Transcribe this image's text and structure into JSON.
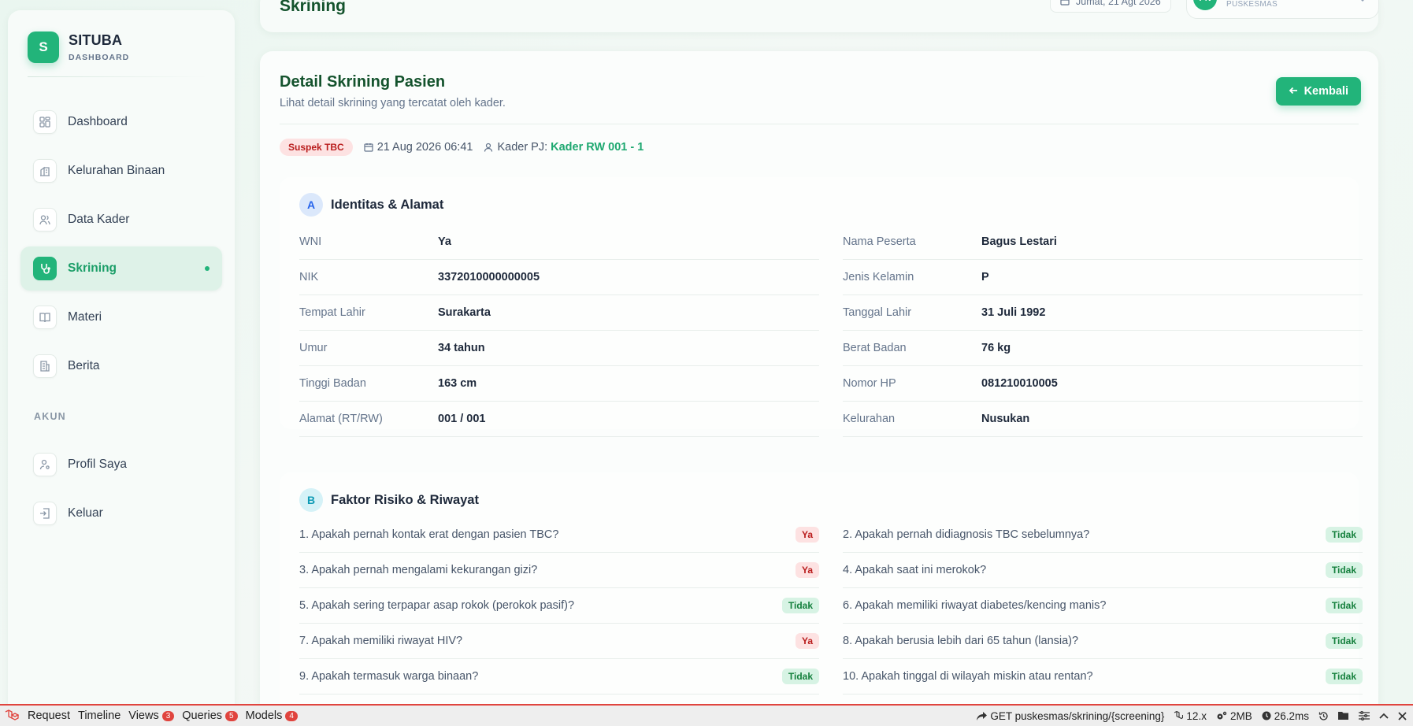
{
  "brand": {
    "logo": "S",
    "title": "SITUBA",
    "subtitle": "DASHBOARD"
  },
  "sidebar": {
    "items": [
      {
        "label": "Dashboard",
        "icon": "grid-icon"
      },
      {
        "label": "Kelurahan Binaan",
        "icon": "building-icon"
      },
      {
        "label": "Data Kader",
        "icon": "users-icon"
      },
      {
        "label": "Skrining",
        "icon": "stethoscope-icon",
        "active": true
      },
      {
        "label": "Materi",
        "icon": "book-icon"
      },
      {
        "label": "Berita",
        "icon": "newspaper-icon"
      }
    ],
    "account_label": "AKUN",
    "account_items": [
      {
        "label": "Profil Saya",
        "icon": "user-gear-icon"
      },
      {
        "label": "Keluar",
        "icon": "logout-icon"
      }
    ]
  },
  "header": {
    "title": "Skrining",
    "date": "Jumat, 21 Agt 2026",
    "user_initials": "PN",
    "user_role": "PUSKESMAS"
  },
  "main": {
    "title": "Detail Skrining Pasien",
    "subtitle": "Lihat detail skrining yang tercatat oleh kader.",
    "back_label": "Kembali",
    "status_badge": "Suspek TBC",
    "timestamp": "21 Aug 2026 06:41",
    "kader_label": "Kader PJ:",
    "kader_name": "Kader RW 001 - 1"
  },
  "section_a": {
    "letter": "A",
    "title": "Identitas & Alamat",
    "left": [
      {
        "label": "WNI",
        "value": "Ya"
      },
      {
        "label": "NIK",
        "value": "3372010000000005"
      },
      {
        "label": "Tempat Lahir",
        "value": "Surakarta"
      },
      {
        "label": "Umur",
        "value": "34 tahun"
      },
      {
        "label": "Tinggi Badan",
        "value": "163 cm"
      },
      {
        "label": "Alamat (RT/RW)",
        "value": "001 / 001"
      }
    ],
    "right": [
      {
        "label": "Nama Peserta",
        "value": "Bagus Lestari"
      },
      {
        "label": "Jenis Kelamin",
        "value": "P"
      },
      {
        "label": "Tanggal Lahir",
        "value": "31 Juli 1992"
      },
      {
        "label": "Berat Badan",
        "value": "76 kg"
      },
      {
        "label": "Nomor HP",
        "value": "081210010005"
      },
      {
        "label": "Kelurahan",
        "value": "Nusukan"
      }
    ]
  },
  "section_b": {
    "letter": "B",
    "title": "Faktor Risiko & Riwayat",
    "left": [
      {
        "q": "1. Apakah pernah kontak erat dengan pasien TBC?",
        "a": "Ya"
      },
      {
        "q": "3. Apakah pernah mengalami kekurangan gizi?",
        "a": "Ya"
      },
      {
        "q": "5. Apakah sering terpapar asap rokok (perokok pasif)?",
        "a": "Tidak"
      },
      {
        "q": "7. Apakah memiliki riwayat HIV?",
        "a": "Ya"
      },
      {
        "q": "9. Apakah termasuk warga binaan?",
        "a": "Tidak"
      }
    ],
    "right": [
      {
        "q": "2. Apakah pernah didiagnosis TBC sebelumnya?",
        "a": "Tidak"
      },
      {
        "q": "4. Apakah saat ini merokok?",
        "a": "Tidak"
      },
      {
        "q": "6. Apakah memiliki riwayat diabetes/kencing manis?",
        "a": "Tidak"
      },
      {
        "q": "8. Apakah berusia lebih dari 65 tahun (lansia)?",
        "a": "Tidak"
      },
      {
        "q": "10. Apakah tinggal di wilayah miskin atau rentan?",
        "a": "Tidak"
      }
    ]
  },
  "debugbar": {
    "tabs": [
      {
        "label": "Request"
      },
      {
        "label": "Timeline"
      },
      {
        "label": "Views",
        "count": "3"
      },
      {
        "label": "Queries",
        "count": "5"
      },
      {
        "label": "Models",
        "count": "4"
      }
    ],
    "route": "GET puskesmas/skrining/{screening}",
    "version": "12.x",
    "memory": "2MB",
    "time": "26.2ms"
  },
  "colors": {
    "accent": "#22b47a",
    "danger": "#e0443e"
  }
}
